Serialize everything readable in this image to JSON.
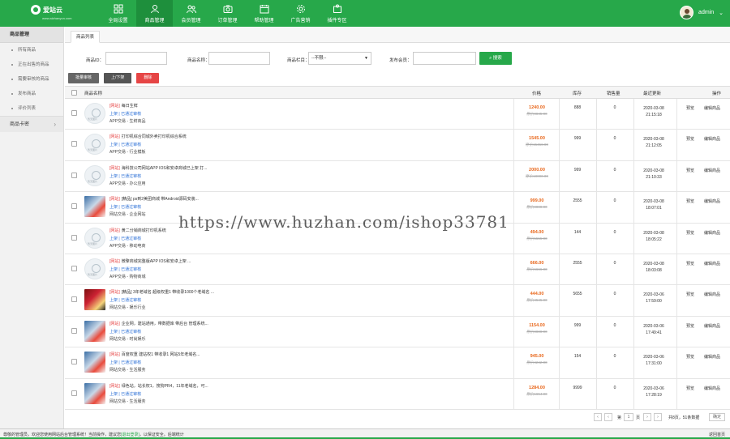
{
  "app": {
    "logo_text": "爱站云",
    "logo_sub": "www.aizhanyun.com",
    "user_name": "admin"
  },
  "nav": [
    {
      "label": "全局设置",
      "icon": "grid-icon"
    },
    {
      "label": "商品管理",
      "icon": "user-icon",
      "active": true
    },
    {
      "label": "会员管理",
      "icon": "people-icon"
    },
    {
      "label": "订单管理",
      "icon": "camera-icon"
    },
    {
      "label": "帮助管理",
      "icon": "calendar-icon"
    },
    {
      "label": "广告营销",
      "icon": "gear-icon"
    },
    {
      "label": "插件专区",
      "icon": "puzzle-icon"
    }
  ],
  "sidebar": {
    "title": "商品管理",
    "items": [
      "所有商品",
      "正在出售的商品",
      "需要审核的商品",
      "发布商品",
      "评价列表"
    ],
    "group": "商品卡密"
  },
  "tab": "商品列表",
  "filters": {
    "id_label": "商品ID：",
    "name_label": "商品名称：",
    "cat_label": "商品栏目：",
    "cat_value": "--不限--",
    "member_label": "发布会员：",
    "search_label": "搜索"
  },
  "actions": {
    "audit": "批量审核",
    "shelf": "上/下架",
    "delete": "删除"
  },
  "columns": {
    "name": "商品名称",
    "price": "价格",
    "stock": "库存",
    "sold": "销售量",
    "updated": "最近更新",
    "ops": "操作"
  },
  "rows": [
    {
      "tag": "[网站]",
      "title": "每日生鲜",
      "status": "上架 | 已通过审核",
      "type": "APP交易 - 生鲜商品",
      "price": "1240.00",
      "old": "原价8845.00",
      "stock": "888",
      "sold": "0",
      "date": "2020-03-08",
      "time": "21:15:18",
      "thumb": "empty"
    },
    {
      "tag": "[网站]",
      "title": "打印机综合同城外卖打印机综合系统",
      "status": "上架 | 已通过审核",
      "type": "APP交易 - 行业模板",
      "price": "1545.00",
      "old": "原价15456.00",
      "stock": "999",
      "sold": "0",
      "date": "2020-03-08",
      "time": "21:12:05",
      "thumb": "empty"
    },
    {
      "tag": "[网站]",
      "title": "海科技公司网站APP IOS和安卓商城已上架 打...",
      "status": "上架 | 已通过审核",
      "type": "APP交易 - 办公应用",
      "price": "2000.00",
      "old": "原价18000.00",
      "stock": "999",
      "sold": "0",
      "date": "2020-03-08",
      "time": "21:10:33",
      "thumb": "empty"
    },
    {
      "tag": "[网站]",
      "title": "[精品] ps到2美团商城 带Android源码安装...",
      "status": "上架 | 已通过审核",
      "type": "网站交易 - 企业网站",
      "price": "999.00",
      "old": "原价8888.00",
      "stock": "2555",
      "sold": "0",
      "date": "2020-03-08",
      "time": "18:07:01",
      "thumb": "photo"
    },
    {
      "tag": "[网站]",
      "title": "黄二分销商城打印机系统",
      "status": "上架 | 已通过审核",
      "type": "APP交易 - 移动电商",
      "price": "494.00",
      "old": "原价5555.00",
      "stock": "144",
      "sold": "0",
      "date": "2020-03-08",
      "time": "18:05:22",
      "thumb": "empty"
    },
    {
      "tag": "[网站]",
      "title": "微擎商城完整版APP IOS和安卓上架 ...",
      "status": "上架 | 已通过审核",
      "type": "APP交易 - 购物商城",
      "price": "666.00",
      "old": "原价6666.00",
      "stock": "2555",
      "sold": "0",
      "date": "2020-03-08",
      "time": "18:03:08",
      "thumb": "empty"
    },
    {
      "tag": "[网站]",
      "title": "[精品] 3年老域名 超级权重1 带收录1000个老域名 ...",
      "status": "上架 | 已通过审核",
      "type": "网站交易 - 娱乐行业",
      "price": "444.00",
      "old": "原价4545.00",
      "stock": "5655",
      "sold": "0",
      "date": "2020-03-06",
      "time": "17:59:00",
      "thumb": "photo-red"
    },
    {
      "tag": "[网站]",
      "title": "企业网，建站通用，带数据库 带后台 管理系统...",
      "status": "上架 | 已通过审核",
      "type": "网站交易 - 时尚娱乐",
      "price": "1154.00",
      "old": "原价8888.00",
      "stock": "999",
      "sold": "0",
      "date": "2020-03-06",
      "time": "17:49:41",
      "thumb": "photo"
    },
    {
      "tag": "[网站]",
      "title": "百度权重 建站权1 带收录1 网站5年老域名...",
      "status": "上架 | 已通过审核",
      "type": "网站交易 - 生活服务",
      "price": "945.00",
      "old": "原价4242.00",
      "stock": "154",
      "sold": "0",
      "date": "2020-03-06",
      "time": "17:31:00",
      "thumb": "photo"
    },
    {
      "tag": "[网站]",
      "title": "绿色站，站长权1，搜狗PR4，11年老域名，可...",
      "status": "上架 | 已通过审核",
      "type": "网站交易 - 生活服务",
      "price": "1284.00",
      "old": "原价1654.00",
      "stock": "9999",
      "sold": "0",
      "date": "2020-03-06",
      "time": "17:28:19",
      "thumb": "photo"
    }
  ],
  "row_ops": {
    "preview": "预览",
    "edit": "编辑商品"
  },
  "pager": {
    "page_prefix": "第",
    "page_current": "1",
    "page_suffix": "页",
    "info": "共8页，51条数据",
    "go": "确定"
  },
  "status": {
    "msg_a": "尊敬的管理员，欢迎您使用网站后台管理系统！当前操作，建议您",
    "msg_link": "[退出登录]",
    "msg_b": "，以保证安全。后端统计",
    "right": "返回首页"
  },
  "watermark": "https://www.huzhan.com/ishop33781",
  "colors": {
    "brand": "#27a84a",
    "price": "#e8661a",
    "tag": "#e64545",
    "link": "#2b6fd6"
  }
}
